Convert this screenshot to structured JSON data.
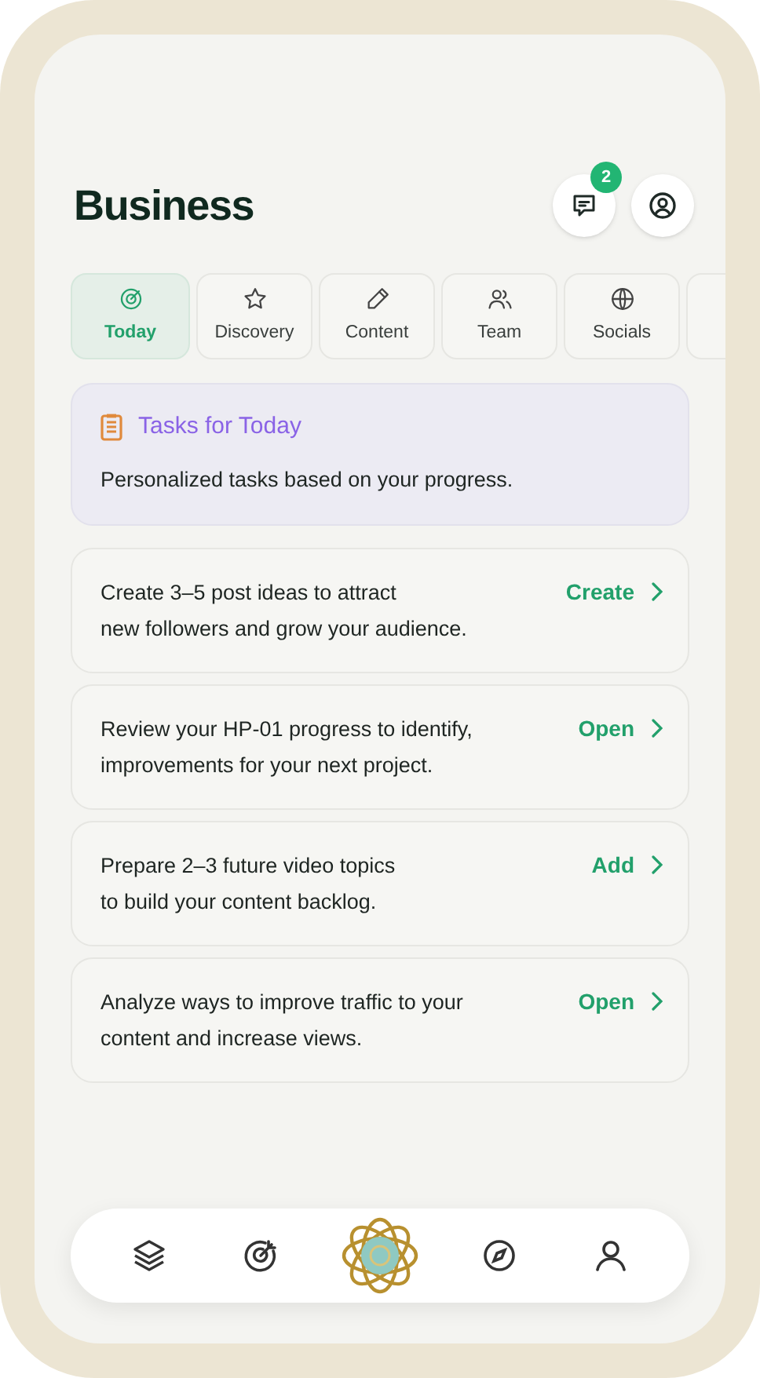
{
  "header": {
    "title": "Business",
    "notifications_badge": "2"
  },
  "tabs": [
    {
      "label": "Today",
      "selected": true
    },
    {
      "label": "Discovery",
      "selected": false
    },
    {
      "label": "Content",
      "selected": false
    },
    {
      "label": "Team",
      "selected": false
    },
    {
      "label": "Socials",
      "selected": false
    }
  ],
  "intro_card": {
    "title": "Tasks for Today",
    "subtitle": "Personalized tasks based on your progress."
  },
  "tasks": [
    {
      "lines": [
        "Create 3–5 post ideas to attract",
        "new followers and grow your audience."
      ],
      "action": "Create"
    },
    {
      "lines": [
        "Review your HP-01 progress to identify,",
        "improvements for your next project."
      ],
      "action": "Open"
    },
    {
      "lines": [
        "Prepare 2–3 future video topics",
        "to build your content backlog."
      ],
      "action": "Add"
    },
    {
      "lines": [
        "Analyze ways to improve traffic to your",
        "content and increase views."
      ],
      "action": "Open"
    }
  ]
}
